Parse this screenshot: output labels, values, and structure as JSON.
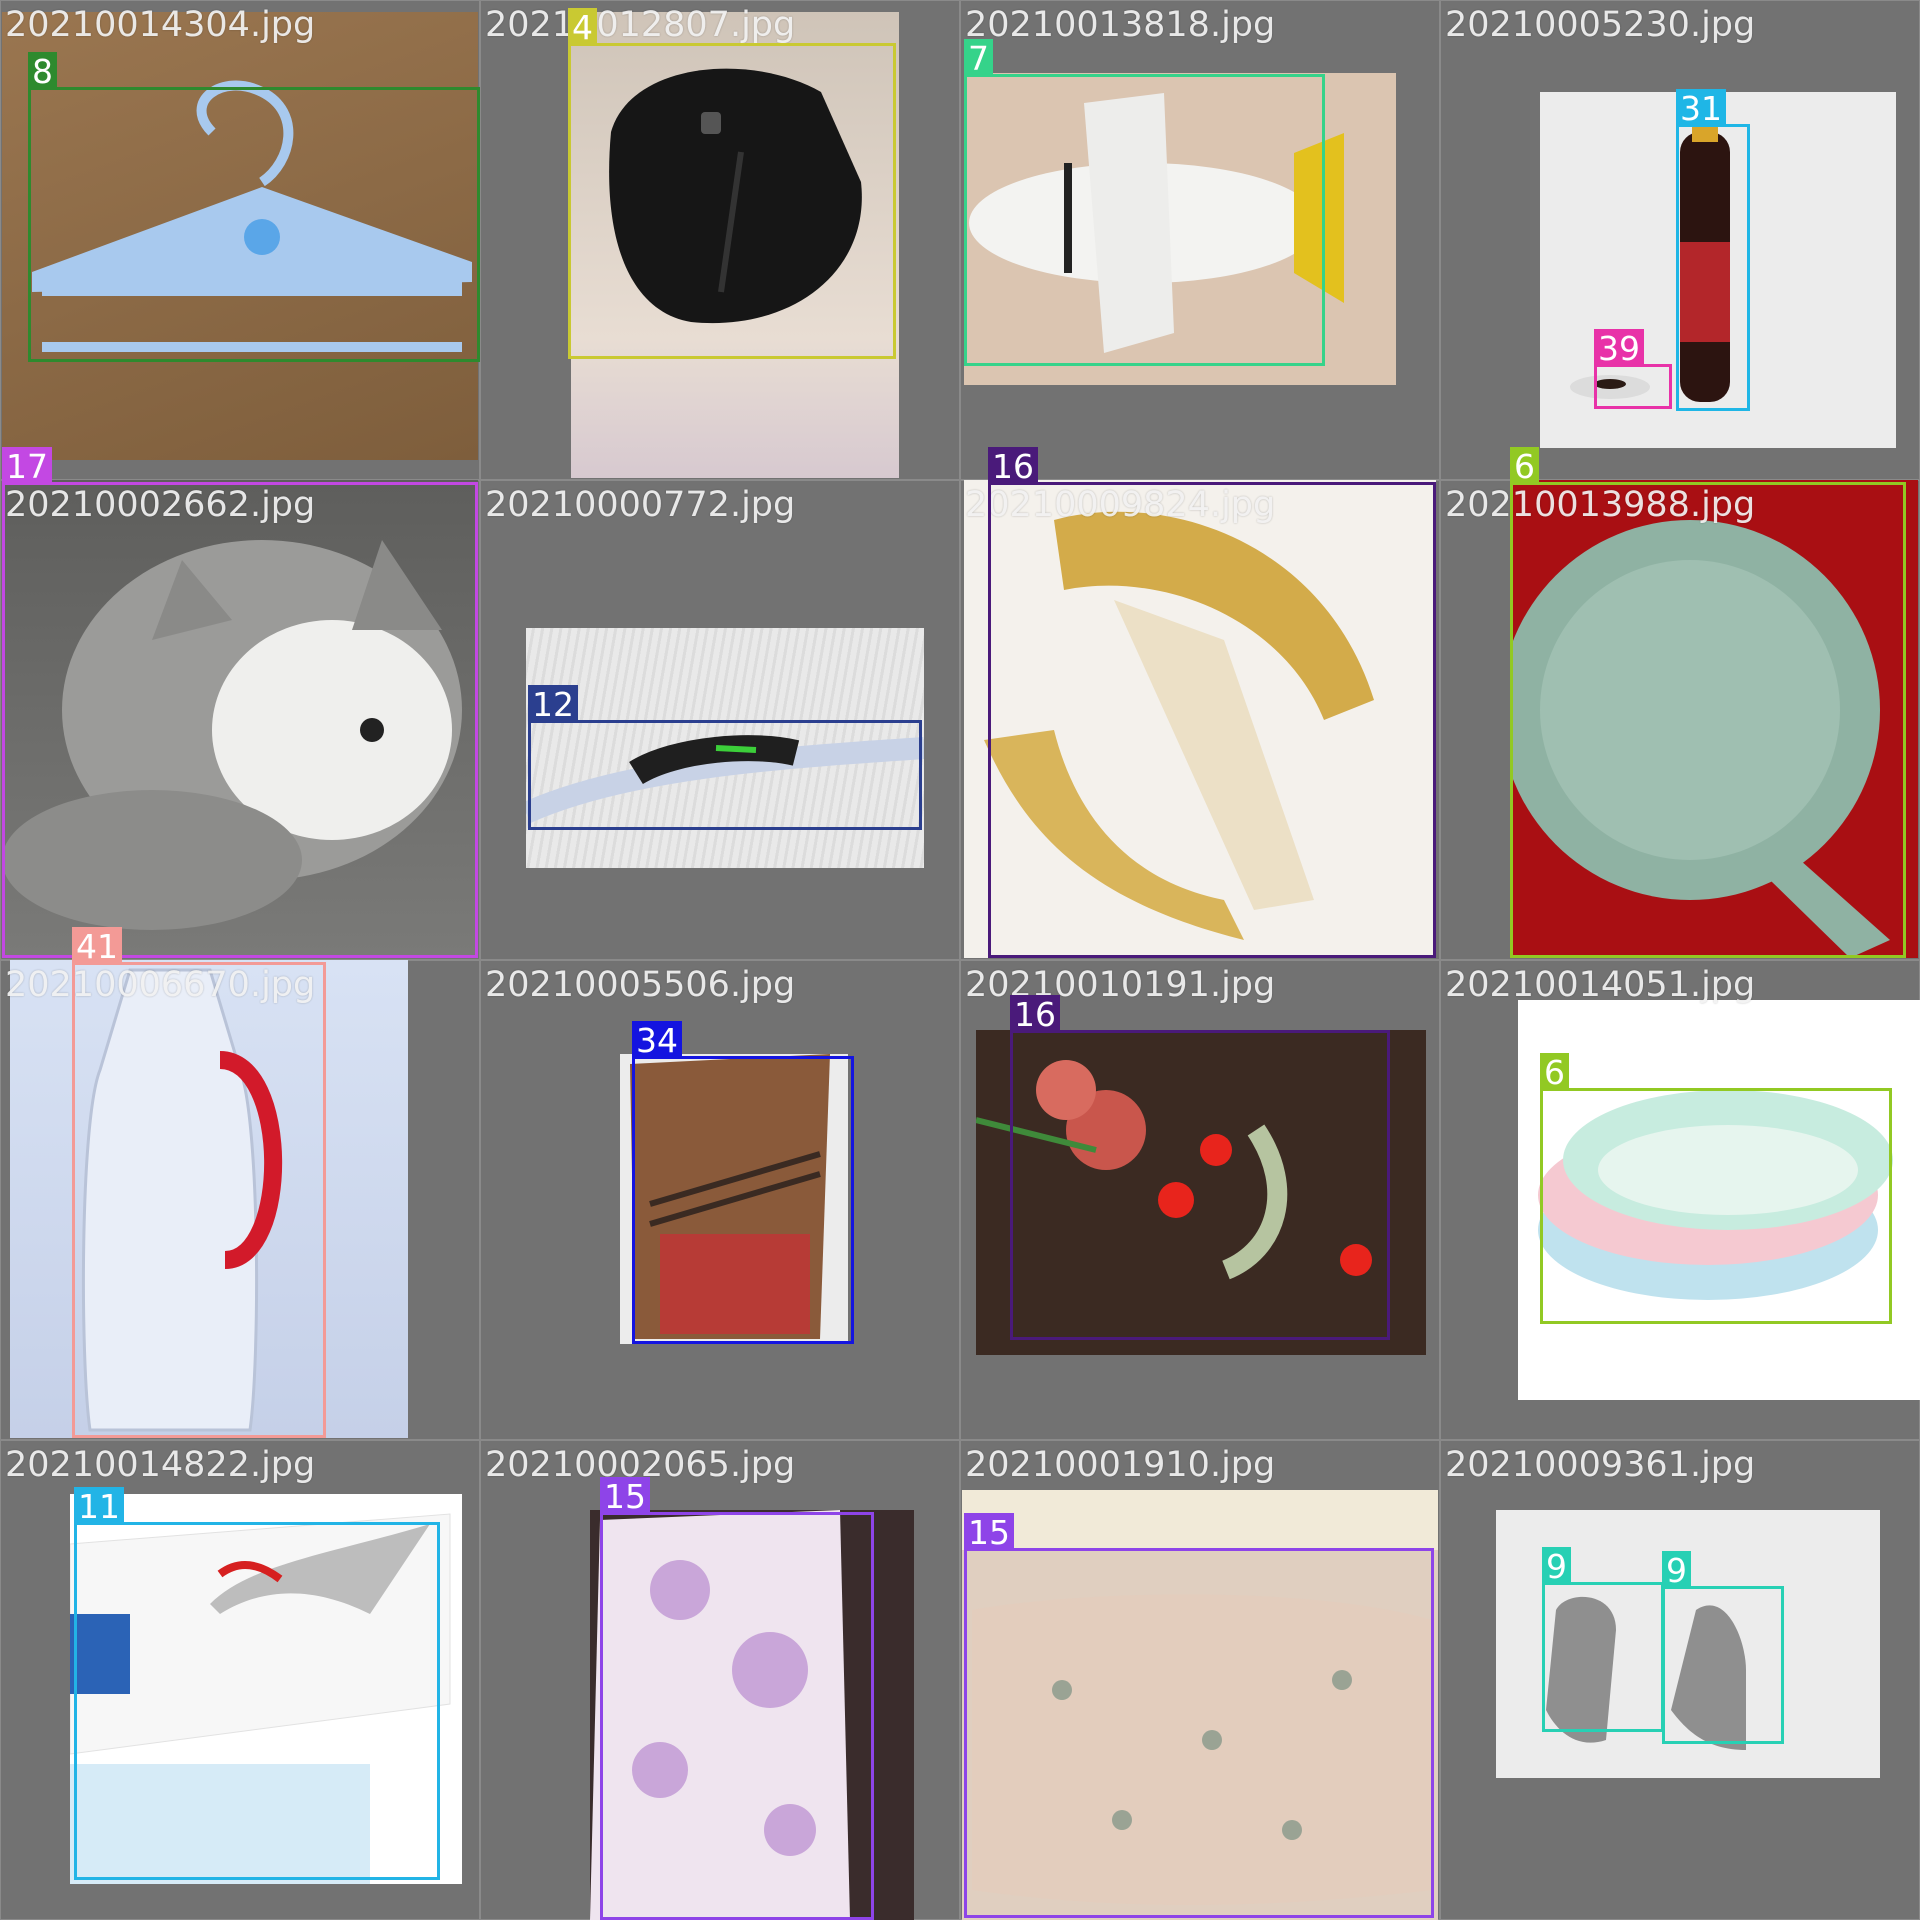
{
  "title": "",
  "tiles": [
    {
      "filename": "20210014304.jpg",
      "photo_bg": "#8b6a47",
      "labels": [
        {
          "text": "8",
          "color": "#2e8a2e"
        }
      ]
    },
    {
      "filename": "20214012807.jpg",
      "photo_bg": "#d8cfc4",
      "labels": [
        {
          "text": "4",
          "color": "#c9c932"
        }
      ]
    },
    {
      "filename": "20210013818.jpg",
      "photo_bg": "#d9c4b0",
      "labels": [
        {
          "text": "7",
          "color": "#35d38a"
        }
      ]
    },
    {
      "filename": "20210005230.jpg",
      "photo_bg": "#ececec",
      "labels": [
        {
          "text": "31",
          "color": "#1fb6e6"
        },
        {
          "text": "39",
          "color": "#e832a8"
        }
      ]
    },
    {
      "filename": "20210002662.jpg",
      "photo_bg": "#6e6e6c",
      "labels": [
        {
          "text": "17",
          "color": "#c348e3"
        }
      ]
    },
    {
      "filename": "20210000772.jpg",
      "photo_bg": "#e6e6e6",
      "labels": [
        {
          "text": "12",
          "color": "#2b3f8f"
        }
      ]
    },
    {
      "filename": "20210009824.jpg",
      "photo_bg": "#f3f0ec",
      "labels": [
        {
          "text": "16",
          "color": "#4a1a7a"
        }
      ]
    },
    {
      "filename": "20210013988.jpg",
      "photo_bg": "#a90f13",
      "labels": [
        {
          "text": "6",
          "color": "#92c923"
        }
      ]
    },
    {
      "filename": "20210006670.jpg",
      "photo_bg": "#c8d4ea",
      "labels": [
        {
          "text": "41",
          "color": "#f39a96"
        }
      ]
    },
    {
      "filename": "20210005506.jpg",
      "photo_bg": "#e9e9e9",
      "labels": [
        {
          "text": "34",
          "color": "#1414e0"
        }
      ]
    },
    {
      "filename": "20210010191.jpg",
      "photo_bg": "#3b2a22",
      "labels": [
        {
          "text": "16",
          "color": "#4a1a7a"
        }
      ]
    },
    {
      "filename": "20210014051.jpg",
      "photo_bg": "#ffffff",
      "labels": [
        {
          "text": "6",
          "color": "#92c923"
        }
      ]
    },
    {
      "filename": "20210014822.jpg",
      "photo_bg": "#ffffff",
      "labels": [
        {
          "text": "11",
          "color": "#22b4e6"
        }
      ]
    },
    {
      "filename": "20210002065.jpg",
      "photo_bg": "#3a2c2c",
      "labels": [
        {
          "text": "15",
          "color": "#8e44e8"
        }
      ]
    },
    {
      "filename": "20210001910.jpg",
      "photo_bg": "#e8dccc",
      "labels": [
        {
          "text": "15",
          "color": "#8e44e8"
        }
      ]
    },
    {
      "filename": "20210009361.jpg",
      "photo_bg": "#ececec",
      "labels": [
        {
          "text": "9",
          "color": "#27d0b4"
        },
        {
          "text": "9",
          "color": "#27d0b4"
        }
      ]
    }
  ]
}
